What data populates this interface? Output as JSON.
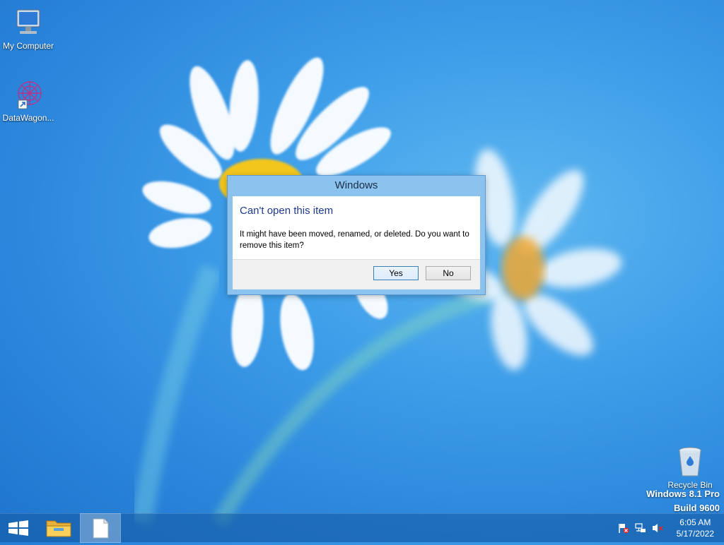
{
  "desktop": {
    "icons": [
      {
        "label": "My Computer",
        "icon": "computer-icon"
      },
      {
        "label": "DataWagon...",
        "icon": "datawagon-icon"
      },
      {
        "label": "Recycle Bin",
        "icon": "recycle-bin-icon"
      }
    ],
    "watermark": {
      "line1": "Windows 8.1 Pro",
      "line2": "Build 9600"
    }
  },
  "dialog": {
    "title": "Windows",
    "heading": "Can't open this item",
    "message": "It might have been moved, renamed, or deleted. Do you want to remove this item?",
    "yes_label": "Yes",
    "no_label": "No"
  },
  "taskbar": {
    "buttons": [
      {
        "icon": "windows-start-icon"
      },
      {
        "icon": "file-explorer-icon"
      },
      {
        "icon": "blank-document-icon",
        "active": true
      }
    ],
    "tray": [
      {
        "icon": "action-center-flag-icon"
      },
      {
        "icon": "network-icon"
      },
      {
        "icon": "speaker-muted-icon"
      }
    ],
    "time": "6:05 AM",
    "date": "5/17/2022"
  },
  "colors": {
    "accent": "#8cc2ee",
    "heading": "#1f3a8a",
    "wallpaper": "#3f9fe9"
  }
}
